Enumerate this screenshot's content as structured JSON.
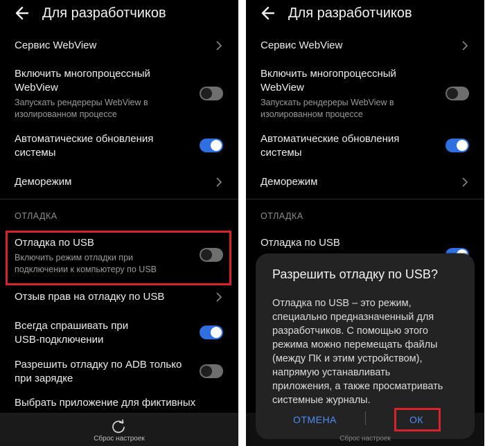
{
  "header": {
    "title": "Для разработчиков"
  },
  "settings": {
    "webview_service": {
      "title": "Сервис WebView"
    },
    "multiprocess": {
      "title_line1": "Включить многопроцессный",
      "title_line2": "WebView",
      "sub_line1": "Запускать рендереры WebView в",
      "sub_line2": "изолированном процессе",
      "enabled": false
    },
    "auto_updates": {
      "title_line1": "Автоматические обновления",
      "title_line2": "системы",
      "enabled": true
    },
    "demo_mode": {
      "title": "Деморежим"
    },
    "section_debug": "ОТЛАДКА",
    "usb_debug": {
      "title": "Отладка по USB",
      "sub_line1": "Включить режим отладки при",
      "sub_line2": "подключении к компьютеру по USB",
      "enabled_left": false,
      "enabled_right": true
    },
    "revoke": {
      "title": "Отзыв прав на отладку по USB"
    },
    "always_ask": {
      "title_line1": "Всегда спрашивать при",
      "title_line2": "USB-подключении",
      "enabled": true
    },
    "adb_charging": {
      "title_line1": "Разрешить отладку по ADB только",
      "title_line2": "при зарядке",
      "enabled": false
    },
    "mock_app": {
      "title": "Выбрать приложение для фиктивных"
    }
  },
  "bottom": {
    "reset_label": "Сброс настроек"
  },
  "dialog": {
    "title": "Разрешить отладку по USB?",
    "body": [
      "Отладка по USB – это режим,",
      "специально предназначенный для",
      "разработчиков. С помощью этого",
      "режима можно перемещать файлы",
      "(между ПК и этим устройством),",
      "напрямую устанавливать",
      "приложения, а также просматривать",
      "системные журналы."
    ],
    "cancel": "ОТМЕНА",
    "ok": "ОК"
  },
  "colors": {
    "accent": "#2f6fe0",
    "highlight": "#d9232c",
    "button_text": "#4d8ef7"
  }
}
